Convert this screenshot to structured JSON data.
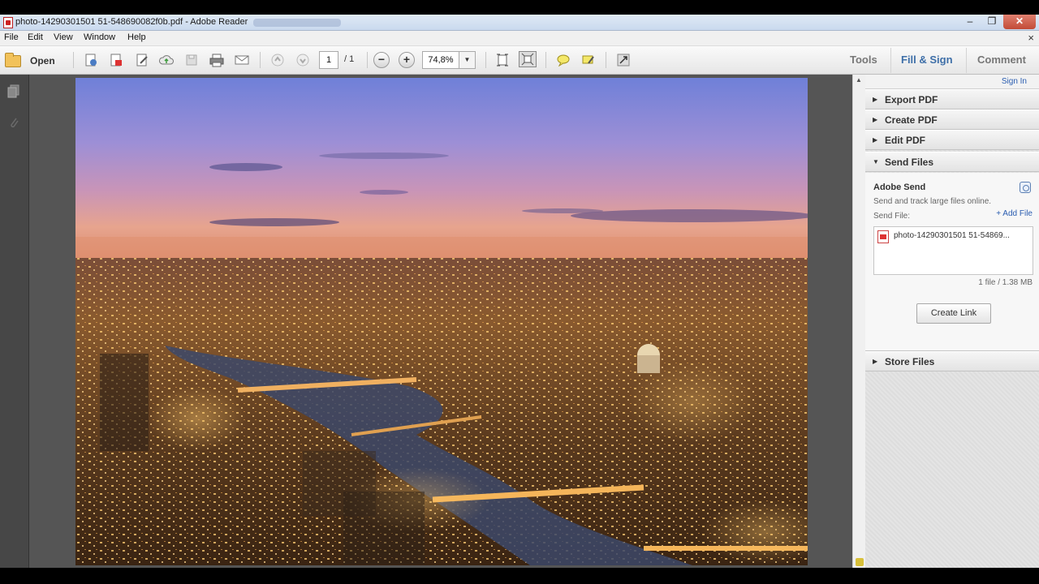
{
  "window": {
    "title": "photo-14290301501 51-548690082f0b.pdf - Adobe Reader",
    "minimize": "–",
    "maximize": "❐",
    "close": "✕"
  },
  "menu": {
    "items": [
      "File",
      "Edit",
      "View",
      "Window",
      "Help"
    ],
    "close": "×"
  },
  "toolbar": {
    "open_label": "Open",
    "page_current": "1",
    "page_total": "/ 1",
    "zoom": "74,8%",
    "zoom_out": "−",
    "zoom_in": "+",
    "tools_label": "Tools",
    "fill_sign_label": "Fill & Sign",
    "comment_label": "Comment",
    "icons": [
      "create-pdf-icon",
      "export-icon",
      "edit-icon",
      "cloud-upload-icon",
      "save-icon",
      "print-icon",
      "email-icon",
      "prev-page-icon",
      "next-page-icon",
      "fit-page-icon",
      "fullscreen-icon",
      "comment-icon",
      "highlight-icon",
      "expand-icon"
    ]
  },
  "sidebar_left": {
    "icons": [
      "pages-icon",
      "attachment-icon"
    ]
  },
  "panel": {
    "sign_in": "Sign In",
    "sections": {
      "export_pdf": "Export PDF",
      "create_pdf": "Create PDF",
      "edit_pdf": "Edit PDF",
      "send_files": "Send Files",
      "store_files": "Store Files"
    },
    "send": {
      "title": "Adobe Send",
      "description": "Send and track large files online.",
      "send_file_label": "Send File:",
      "add_file": "+ Add File",
      "file_name": "photo-14290301501 51-54869...",
      "count": "1 file / 1.38 MB",
      "create_link": "Create Link"
    }
  },
  "colors": {
    "panel_link": "#2a5db0",
    "fill_sign_accent": "#3e6fa8",
    "doc_background": "#555555"
  }
}
